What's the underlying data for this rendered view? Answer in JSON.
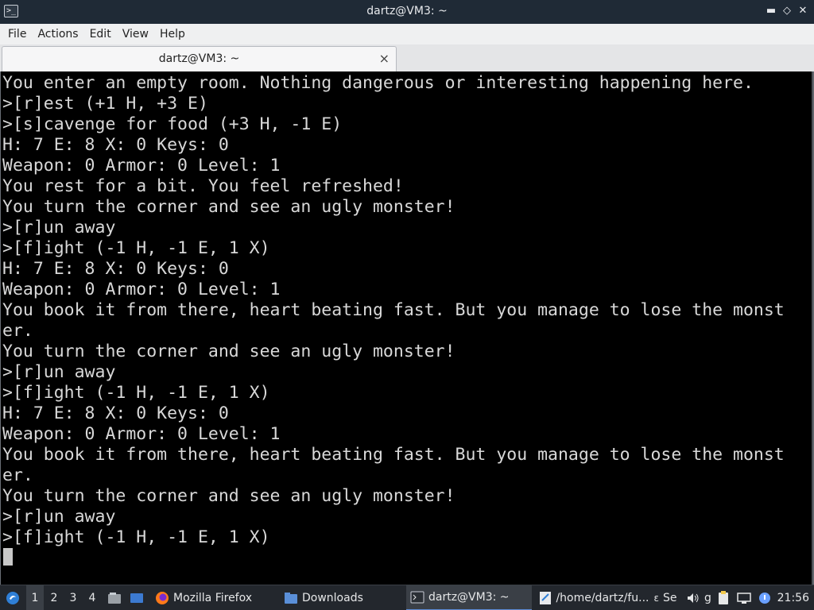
{
  "window": {
    "title": "dartz@VM3: ~",
    "controls": {
      "minimize": "▬",
      "maximize": "◇",
      "close": "✕"
    }
  },
  "menubar": {
    "items": [
      "File",
      "Actions",
      "Edit",
      "View",
      "Help"
    ]
  },
  "tab": {
    "label": "dartz@VM3: ~",
    "close": "×"
  },
  "terminal": {
    "lines": [
      "You enter an empty room. Nothing dangerous or interesting happening here.",
      ">[r]est (+1 H, +3 E)",
      ">[s]cavenge for food (+3 H, -1 E)",
      "H: 7 E: 8 X: 0 Keys: 0",
      "Weapon: 0 Armor: 0 Level: 1",
      "You rest for a bit. You feel refreshed!",
      "You turn the corner and see an ugly monster!",
      ">[r]un away",
      ">[f]ight (-1 H, -1 E, 1 X)",
      "H: 7 E: 8 X: 0 Keys: 0",
      "Weapon: 0 Armor: 0 Level: 1",
      "You book it from there, heart beating fast. But you manage to lose the monst",
      "er.",
      "You turn the corner and see an ugly monster!",
      ">[r]un away",
      ">[f]ight (-1 H, -1 E, 1 X)",
      "H: 7 E: 8 X: 0 Keys: 0",
      "Weapon: 0 Armor: 0 Level: 1",
      "You book it from there, heart beating fast. But you manage to lose the monst",
      "er.",
      "You turn the corner and see an ugly monster!",
      ">[r]un away",
      ">[f]ight (-1 H, -1 E, 1 X)"
    ]
  },
  "taskbar": {
    "workspaces": [
      "1",
      "2",
      "3",
      "4"
    ],
    "active_workspace": "1",
    "tasks": [
      {
        "label": "Mozilla Firefox",
        "icon": "firefox-icon"
      },
      {
        "label": "Downloads",
        "icon": "folder-icon"
      },
      {
        "label": "dartz@VM3: ~",
        "icon": "terminal-icon"
      },
      {
        "label": "/home/dartz/fu...",
        "icon": "text-editor-icon"
      }
    ],
    "tray_partial": {
      "a": "ε",
      "b": "Se",
      "c": "g"
    },
    "clock": "21:56"
  },
  "colors": {
    "titlebar_bg": "#1f2a36",
    "terminal_bg": "#000000",
    "terminal_fg": "#d8d8d8",
    "taskbar_bg": "#23272d",
    "accent": "#3aa0ff"
  }
}
